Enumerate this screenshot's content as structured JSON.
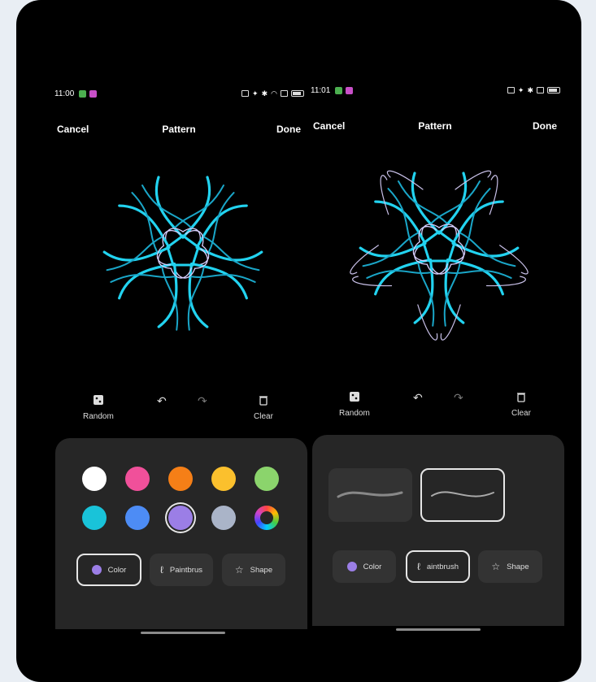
{
  "left": {
    "status": {
      "time": "11:00"
    },
    "header": {
      "cancel": "Cancel",
      "title": "Pattern",
      "done": "Done"
    },
    "tools": {
      "random": "Random",
      "clear": "Clear"
    },
    "palette": [
      "#ffffff",
      "#f0509a",
      "#f57f17",
      "#fbc02d",
      "#8bd46c",
      "#19c3d9",
      "#4d8cf5",
      "#9b7ee6",
      "#aab4c8",
      "rainbow"
    ],
    "selected_color_index": 7,
    "tabs": {
      "color": "Color",
      "paintbrush": "Paintbrus",
      "shape": "Shape",
      "active": "Color"
    }
  },
  "right": {
    "status": {
      "time": "11:01"
    },
    "header": {
      "cancel": "Cancel",
      "title": "Pattern",
      "done": "Done"
    },
    "tools": {
      "random": "Random",
      "clear": "Clear"
    },
    "brushes_selected_index": 1,
    "tabs": {
      "color": "Color",
      "paintbrush": "aintbrush",
      "shape": "Shape",
      "active": "Paintbrush"
    }
  },
  "colors": {
    "accent": "#9b7ee6",
    "art": "#22d3f0",
    "panel": "#262626"
  }
}
